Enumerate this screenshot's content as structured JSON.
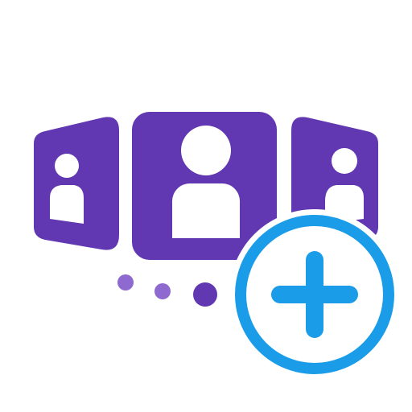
{
  "icon": {
    "name": "add-participant-carousel-icon",
    "colors": {
      "background": "#ffffff",
      "purple": "#6238b2",
      "purple_light": "#8e6ad0",
      "blue": "#1a9ce8",
      "white": "#ffffff"
    },
    "parts": [
      "left-profile-card-icon",
      "center-profile-card-icon",
      "right-profile-card-icon",
      "carousel-dots",
      "add-plus-icon"
    ]
  }
}
